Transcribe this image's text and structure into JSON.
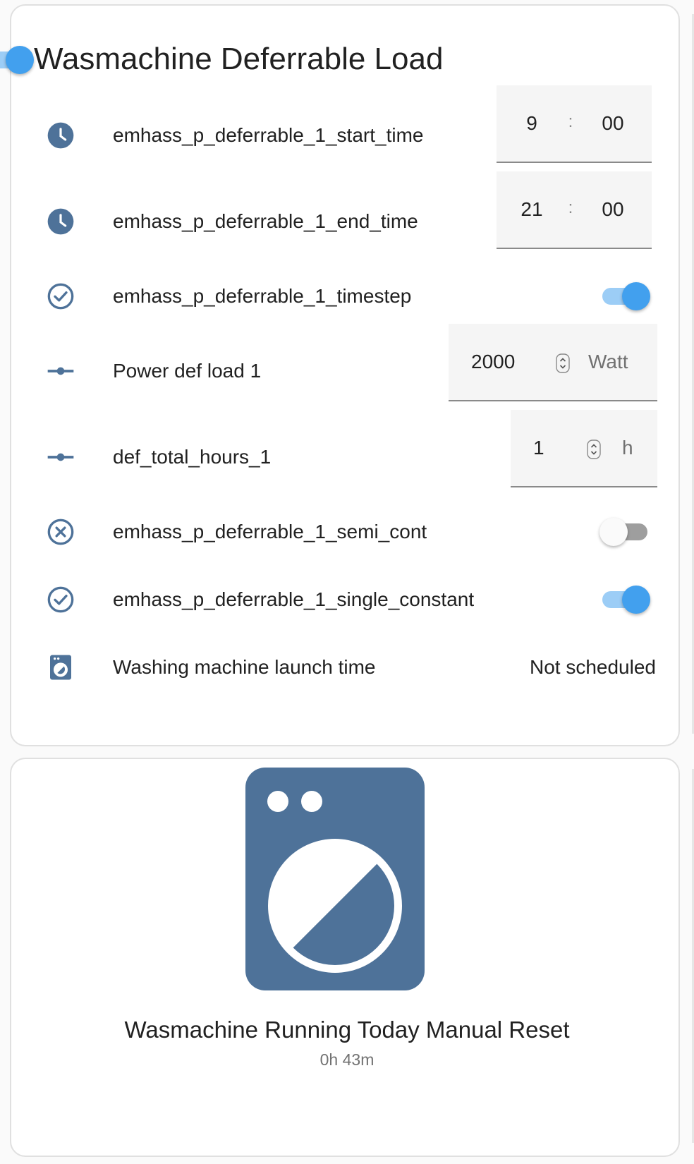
{
  "colors": {
    "icon_blue": "#4e7299",
    "toggle_on": "#42a0ee",
    "toggle_on_track": "#9ccdf6",
    "toggle_off_track": "#9e9e9e"
  },
  "card1": {
    "title": "Wasmachine Deferrable Load",
    "header_toggle_on": true,
    "rows": [
      {
        "icon": "clock-icon",
        "label": "emhass_p_deferrable_1_start_time",
        "hours": "9",
        "separator": ":",
        "minutes": "00"
      },
      {
        "icon": "clock-icon",
        "label": "emhass_p_deferrable_1_end_time",
        "hours": "21",
        "separator": ":",
        "minutes": "00"
      },
      {
        "icon": "check-circle-icon",
        "label": "emhass_p_deferrable_1_timestep",
        "toggle_on": true
      },
      {
        "icon": "slider-icon",
        "label": "Power def load 1",
        "value": "2000",
        "unit": "Watt"
      },
      {
        "icon": "slider-icon",
        "label": "def_total_hours_1",
        "value": "1",
        "unit": "h"
      },
      {
        "icon": "close-circle-icon",
        "label": "emhass_p_deferrable_1_semi_cont",
        "toggle_on": false
      },
      {
        "icon": "check-circle-icon",
        "label": "emhass_p_deferrable_1_single_constant",
        "toggle_on": true
      },
      {
        "icon": "washing-machine-icon",
        "label": "Washing machine launch time",
        "state": "Not scheduled"
      }
    ]
  },
  "card2": {
    "icon": "washing-machine-icon",
    "title": "Wasmachine Running Today Manual Reset",
    "subtitle": "0h 43m"
  }
}
